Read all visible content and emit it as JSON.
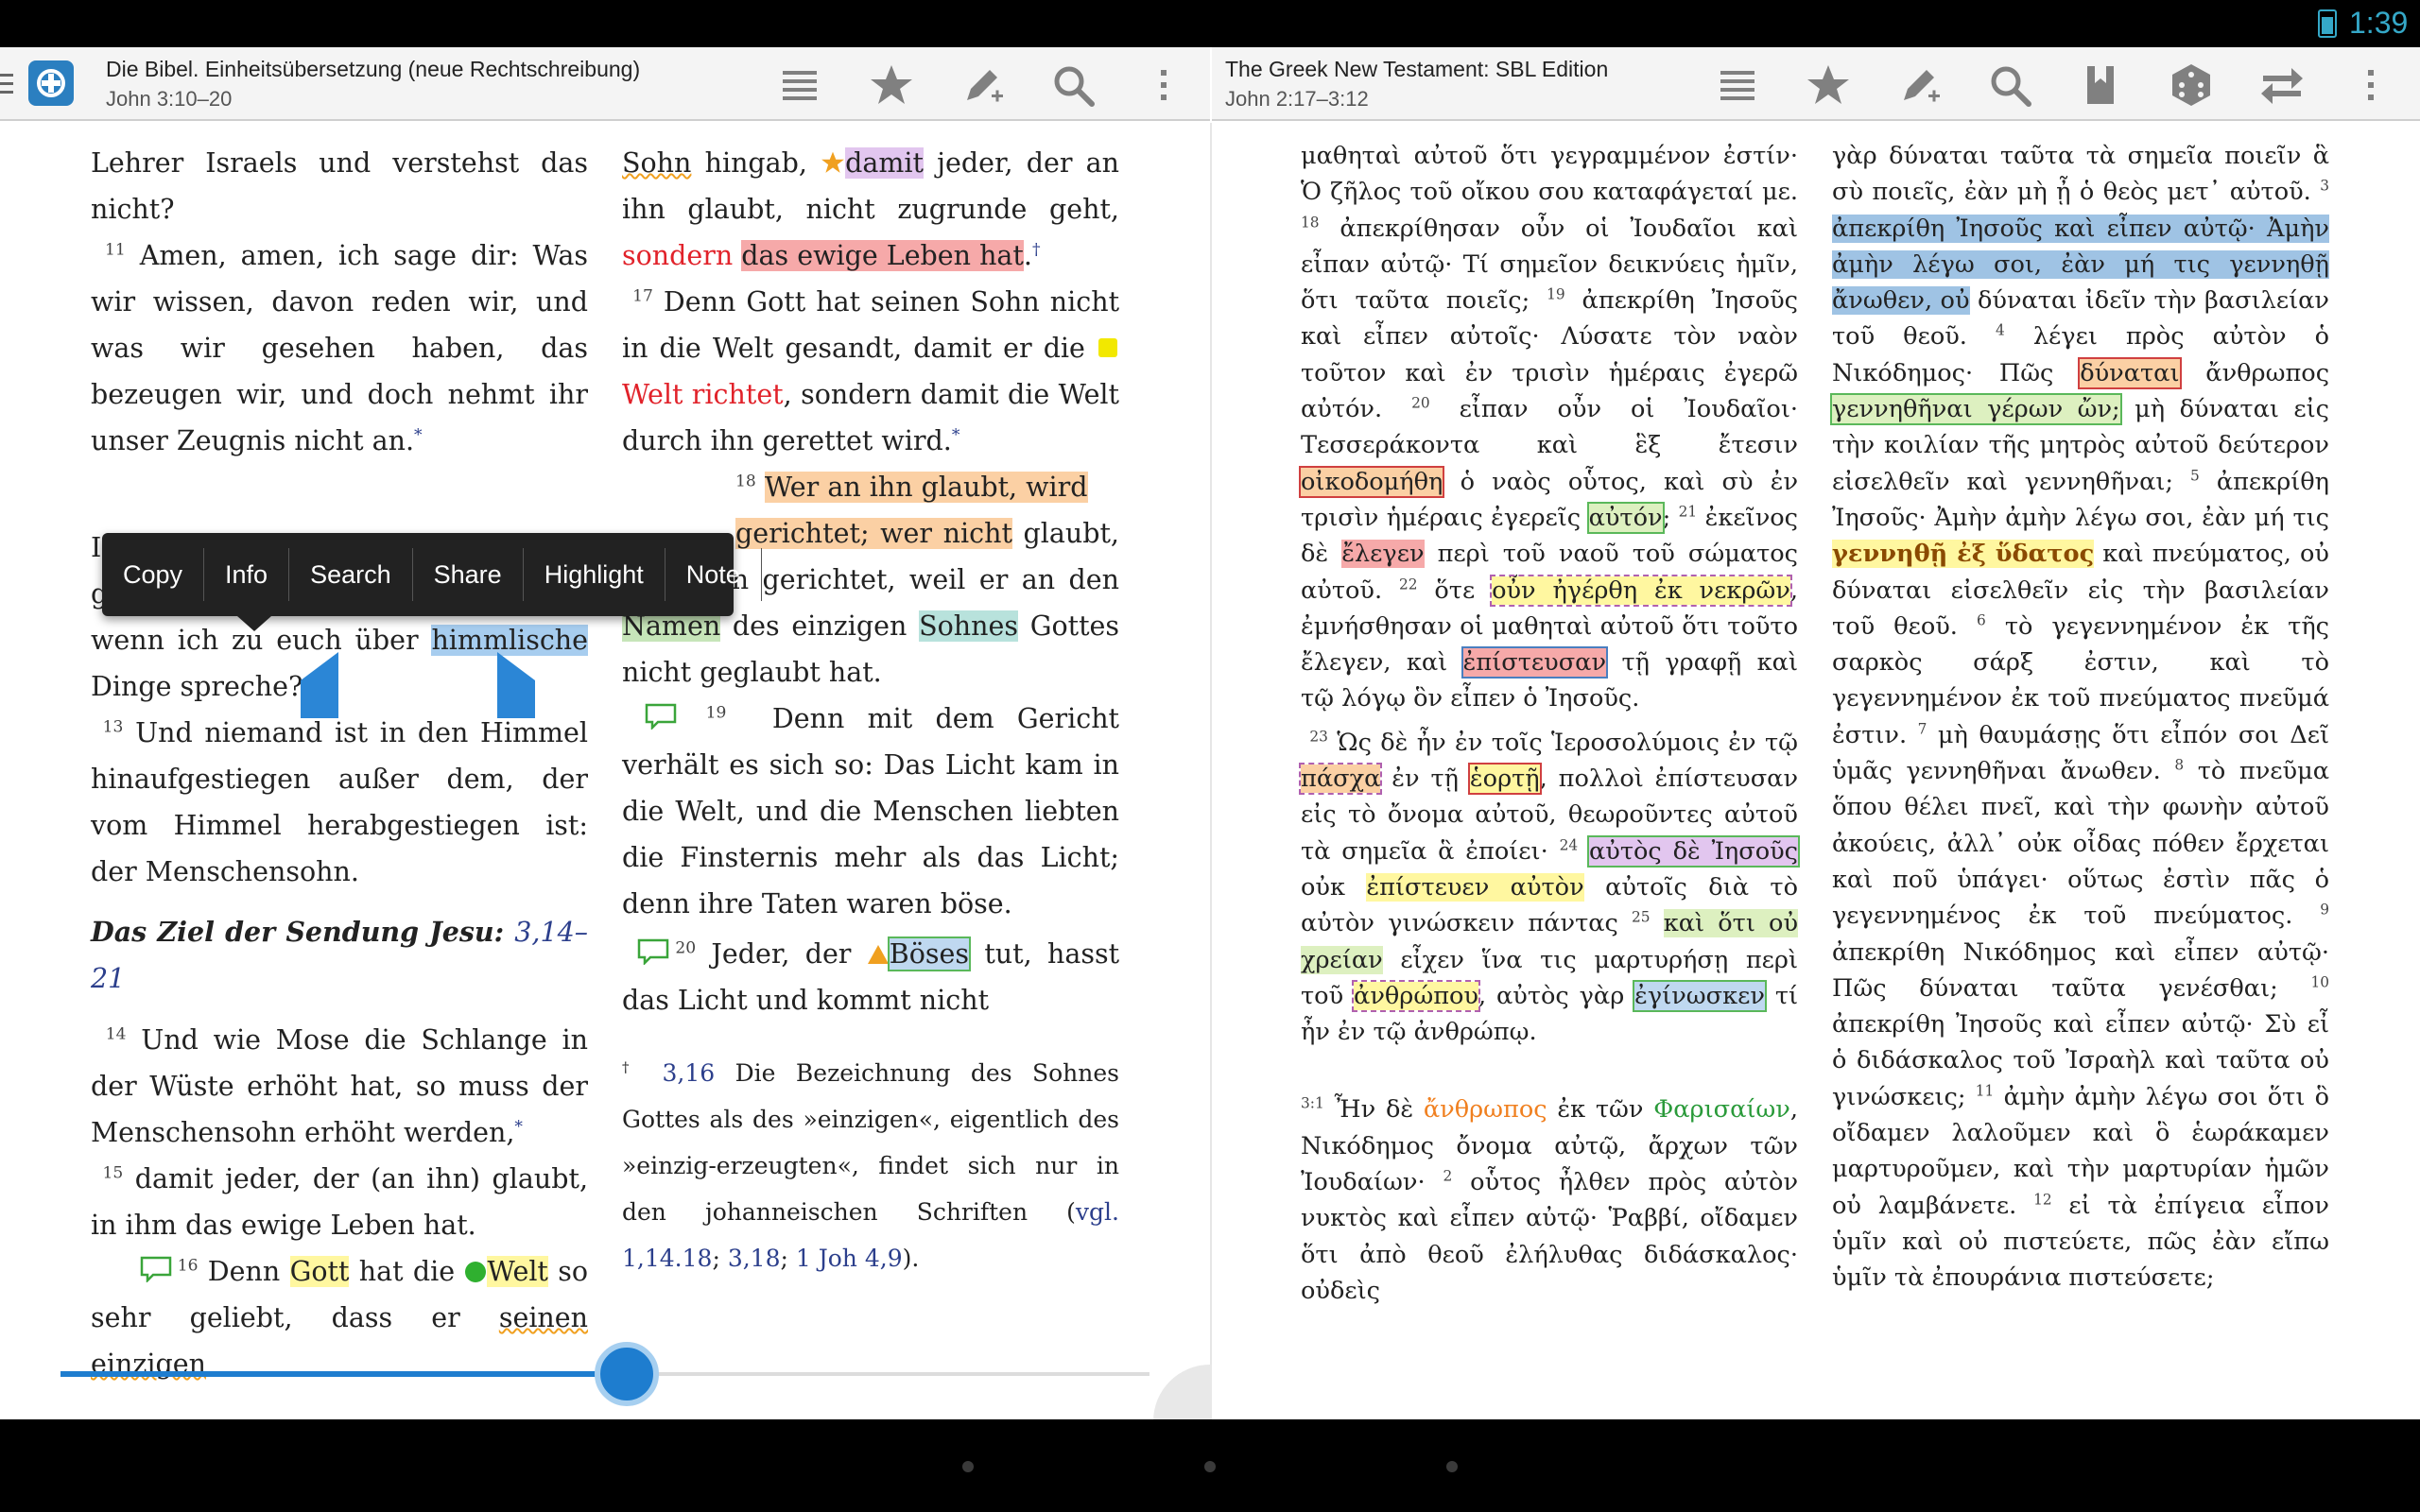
{
  "status": {
    "time": "1:39"
  },
  "left": {
    "title": "Die Bibel. Einheitsübersetzung (neue Rechtschreibung)",
    "reference": "John 3:10–20",
    "col1": {
      "p1_a": "Lehrer Israels und verstehst das nicht?",
      "v11": "11",
      "p2": "Amen, amen, ich sage dir: Was wir wissen, davon reden wir, und was wir gesehen haben, das bezeugen wir, und doch nehmt ihr unser Zeugnis nicht an.",
      "star": "*",
      "p3_lead": "I",
      "p3_b": "glaubt, wie werdet ihr glauben, wenn ich zu euch über",
      "selected": "himmlische",
      "p3_c": "Dinge spreche?",
      "v13": "13",
      "p4": "Und niemand ist in den Himmel hinaufgestiegen außer dem, der vom Himmel herabgestiegen ist: der Menschensohn.",
      "heading": "Das Ziel der Sendung Jesu:",
      "heading_ref": "3,14–21",
      "v14": "14",
      "p5": "Und wie Mose die Schlange in der Wüste erhöht hat, so muss der Menschensohn erhöht werden,",
      "v15": "15",
      "p6": "damit jeder, der (an ihn) glaubt, in ihm das ewige Leben hat.",
      "v16": "16",
      "p7_a": "Denn",
      "gott": "Gott",
      "p7_b": "hat die",
      "welt": "Welt",
      "p7_c": "so sehr geliebt, dass er",
      "seinen": "seinen",
      "einzigen": "einzigen"
    },
    "col2": {
      "sohn": "Sohn",
      "hingab": "hingab,",
      "damit": "damit",
      "p1_a": "jeder, der an ihn glaubt, nicht zugrunde geht,",
      "sondern": "sondern",
      "leben": "das ewige Leben hat",
      "dagger": "†",
      "v17": "17",
      "p2_a": "Denn Gott hat seinen Sohn nicht in die Welt gesandt, damit er die",
      "welt_richtet": "Welt richtet",
      "p2_b": ", sondern damit die Welt durch ihn gerettet wird.",
      "v18": "18",
      "wer": "Wer an ihn glaubt, wird",
      "gerichtet": "gerichtet; wer nicht",
      "p3_b": "glaubt, ist schon gerichtet, weil er an den",
      "namen": "Namen",
      "p3_c": "des einzigen",
      "sohnes": "Sohnes",
      "p3_d": "Gottes nicht geglaubt hat.",
      "v19": "19",
      "p4": "Denn mit dem Gericht verhält es sich so: Das Licht kam in die Welt, und die Menschen liebten die Finsternis mehr als das Licht; denn ihre Taten waren böse.",
      "v20": "20",
      "p5_a": "Jeder, der",
      "boses": "Böses",
      "p5_b": "tut, hasst das Licht und kommt nicht",
      "fn_mark": "†",
      "fn_ref": "3,16",
      "fn_text": "Die Bezeichnung des Sohnes Gottes als des »einzigen«, eigentlich des »einzig-erzeugten«, findet sich nur in den johanneischen Schriften (",
      "fn_link1": "vgl. 1,14.18",
      "fn_sep1": "; ",
      "fn_link2": "3,18",
      "fn_sep2": ";",
      "fn_link3": "1 Joh 4,9",
      "fn_end": ")."
    },
    "context_menu": [
      "Copy",
      "Info",
      "Search",
      "Share",
      "Highlight",
      "Note"
    ],
    "scroll_fraction": 0.52
  },
  "right": {
    "title": "The Greek New Testament: SBL Edition",
    "reference": "John 2:17–3:12",
    "col1": {
      "a": "μαθηταὶ αὐτοῦ ὅτι γεγραμμένον ἐστίν· Ὁ ζῆλος τοῦ οἴκου σου καταφάγεταί με.",
      "v18": "18",
      "b": "ἀπεκρίθησαν οὖν οἱ Ἰουδαῖοι καὶ εἶπαν αὐτῷ· Τί σημεῖον δεικνύεις ἡμῖν, ὅτι ταῦτα ποιεῖς;",
      "v19": "19",
      "c": "ἀπεκρίθη Ἰησοῦς καὶ εἶπεν αὐτοῖς· Λύσατε τὸν ναὸν τοῦτον καὶ ἐν τρισὶν ἡμέραις ἐγερῶ αὐτόν.",
      "v20": "20",
      "d": "εἶπαν οὖν οἱ Ἰουδαῖοι· Τεσσεράκοντα καὶ ἓξ ἔτεσιν",
      "oikodomethe": "οἰκοδομήθη",
      "e": "ὁ ναὸς οὗτος, καὶ σὺ ἐν τρισὶν ἡμέραις ἐγερεῖς",
      "auton": "αὐτόν",
      "v21": "21",
      "f": "ἐκεῖνος δὲ",
      "elegen": "ἔλεγεν",
      "g": "περὶ τοῦ ναοῦ τοῦ σώματος αὐτοῦ.",
      "v22": "22",
      "h": "ὅτε",
      "egerthe": "οὖν ἠγέρθη ἐκ νεκρῶν",
      "i": ", ἐμνήσθησαν οἱ μαθηταὶ αὐτοῦ ὅτι τοῦτο ἔλεγεν, καὶ",
      "episteusan": "ἐπίστευσαν",
      "j": "τῇ γραφῇ καὶ τῷ λόγῳ ὃν εἶπεν ὁ Ἰησοῦς.",
      "v23": "23",
      "k": "Ὡς δὲ ἦν ἐν τοῖς Ἱεροσολύμοις ἐν τῷ",
      "pascha": "πάσχα",
      "l": "ἐν τῇ",
      "eorte": "ἑορτῇ",
      "m": ", πολλοὶ ἐπίστευσαν εἰς τὸ ὄνομα αὐτοῦ, θεωροῦντες αὐτοῦ τὰ σημεῖα ἃ ἐποίει·",
      "v24": "24",
      "autos": "αὐτὸς δὲ Ἰησοῦς",
      "n": "οὐκ",
      "episteuen": "ἐπίστευεν αὐτὸν",
      "o": "αὐτοῖς διὰ τὸ αὐτὸν γινώσκειν πάντας",
      "v25": "25",
      "kai_hoti": "καὶ ὅτι οὐ χρείαν",
      "p": "εἶχεν ἵνα τις μαρτυρήσῃ περὶ τοῦ",
      "anthropou": "ἀνθρώπου",
      "q": ", αὐτὸς γὰρ",
      "eginosken": "ἐγίνωσκεν",
      "r": "τί ἦν ἐν τῷ ἀνθρώπῳ.",
      "v31": "3:1",
      "s": "Ἦν δὲ",
      "anthropos": "ἄνθρωπος",
      "t": "ἐκ τῶν",
      "pharisaion": "Φαρισαίων",
      "u": ", Νικόδημος ὄνομα αὐτῷ, ἄρχων τῶν Ἰουδαίων·",
      "v2": "2",
      "w": "οὗτος ἦλθεν πρὸς αὐτὸν νυκτὸς καὶ εἶπεν αὐτῷ· Ῥαββί, οἴδαμεν ὅτι ἀπὸ θεοῦ ἐλήλυθας διδάσκαλος· οὐδεὶς"
    },
    "col2": {
      "a": "γὰρ δύναται ταῦτα τὰ σημεῖα ποιεῖν ἃ σὺ ποιεῖς, ἐὰν μὴ ᾖ ὁ θεὸς μετ᾽ αὐτοῦ.",
      "v3": "3",
      "sel1": "ἀπεκρίθη Ἰησοῦς καὶ εἶπεν αὐτῷ· Ἀμὴν ἀμὴν λέγω σοι, ἐὰν μή τις γεννηθῇ ἄνωθεν, οὐ",
      "b": "δύναται ἰδεῖν τὴν βασιλείαν τοῦ θεοῦ.",
      "v4": "4",
      "c": "λέγει πρὸς αὐτὸν ὁ Νικόδημος· Πῶς",
      "dynatai": "δύναται",
      "d": "ἄνθρωπος",
      "gennethenai": "γεννηθῆναι γέρων ὤν;",
      "e": "μὴ δύναται εἰς τὴν κοιλίαν τῆς μητρὸς αὐτοῦ δεύτερον εἰσελθεῖν καὶ γεννηθῆναι;",
      "v5": "5",
      "f": "ἀπεκρίθη Ἰησοῦς· Ἀμὴν ἀμὴν λέγω σοι, ἐὰν μή τις",
      "gennethe": "γεννηθῇ ἐξ ὕδατος",
      "g": "καὶ πνεύματος, οὐ δύναται εἰσελθεῖν εἰς τὴν βασιλείαν τοῦ θεοῦ.",
      "v6": "6",
      "h": "τὸ γεγεννημένον ἐκ τῆς σαρκὸς σάρξ ἐστιν, καὶ τὸ γεγεννημένον ἐκ τοῦ πνεύματος πνεῦμά ἐστιν.",
      "v7": "7",
      "i": "μὴ θαυμάσῃς ὅτι εἶπόν σοι Δεῖ ὑμᾶς γεννηθῆναι ἄνωθεν.",
      "v8": "8",
      "j": "τὸ πνεῦμα ὅπου θέλει πνεῖ, καὶ τὴν φωνὴν αὐτοῦ ἀκούεις, ἀλλ᾽ οὐκ οἶδας πόθεν ἔρχεται καὶ ποῦ ὑπάγει· οὕτως ἐστὶν πᾶς ὁ γεγεννημένος ἐκ τοῦ πνεύματος.",
      "v9": "9",
      "k": "ἀπεκρίθη Νικόδημος καὶ εἶπεν αὐτῷ· Πῶς δύναται ταῦτα γενέσθαι;",
      "v10": "10",
      "l": "ἀπεκρίθη Ἰησοῦς καὶ εἶπεν αὐτῷ· Σὺ εἶ ὁ διδάσκαλος τοῦ Ἰσραὴλ καὶ ταῦτα οὐ γινώσκεις;",
      "v11": "11",
      "m": "ἀμὴν ἀμὴν λέγω σοι ὅτι ὃ οἴδαμεν λαλοῦμεν καὶ ὃ ἑωράκαμεν μαρτυροῦμεν, καὶ τὴν μαρτυρίαν ἡμῶν οὐ λαμβάνετε.",
      "v12": "12",
      "n": "εἰ τὰ ἐπίγεια εἶπον ὑμῖν καὶ οὐ πιστεύετε, πῶς ἐὰν εἴπω ὑμῖν τὰ ἐπουράνια πιστεύσετε;"
    }
  },
  "colors": {
    "accent": "#1e7dcf",
    "icon": "#808080"
  }
}
